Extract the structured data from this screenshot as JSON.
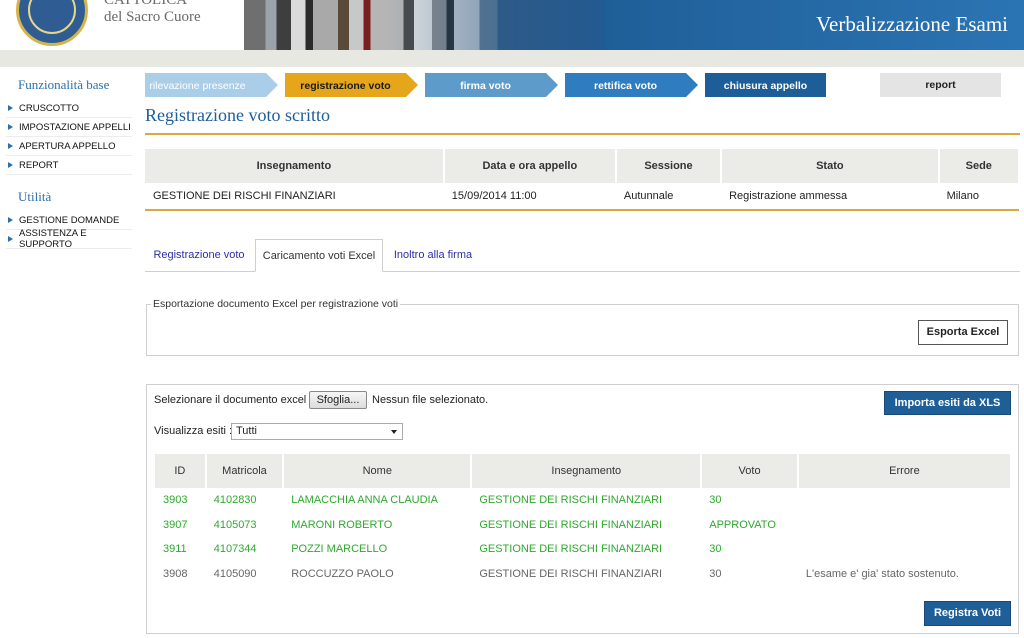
{
  "header": {
    "university_line1": "CATTOLICA",
    "university_line2": "del Sacro Cuore",
    "app_title": "Verbalizzazione Esami"
  },
  "sidebar": {
    "section1_title": "Funzionalità base",
    "section1_items": [
      "CRUSCOTTO",
      "IMPOSTAZIONE APPELLI",
      "APERTURA APPELLO",
      "REPORT"
    ],
    "section2_title": "Utilità",
    "section2_items": [
      "GESTIONE DOMANDE",
      "ASSISTENZA E SUPPORTO"
    ]
  },
  "steps": [
    {
      "label": "rilevazione presenze",
      "state": "done"
    },
    {
      "label": "registrazione voto",
      "state": "current"
    },
    {
      "label": "firma voto",
      "state": "todo"
    },
    {
      "label": "rettifica voto",
      "state": "todo"
    },
    {
      "label": "chiusura appello",
      "state": "todo-dark"
    }
  ],
  "report_label": "report",
  "page_title": "Registrazione voto scritto",
  "exam_table": {
    "headers": [
      "Insegnamento",
      "Data e ora appello",
      "Sessione",
      "Stato",
      "Sede"
    ],
    "row": [
      "GESTIONE DEI RISCHI FINANZIARI",
      "15/09/2014 11:00",
      "Autunnale",
      "Registrazione ammessa",
      "Milano"
    ]
  },
  "tabs": [
    {
      "label": "Registrazione voto",
      "active": false
    },
    {
      "label": "Caricamento voti Excel",
      "active": true
    },
    {
      "label": "Inoltro alla firma",
      "active": false
    }
  ],
  "export": {
    "legend": "Esportazione documento Excel per registrazione voti",
    "button": "Esporta Excel"
  },
  "import": {
    "select_doc_label": "Selezionare il documento excel :",
    "browse_button": "Sfoglia...",
    "no_file_text": "Nessun file selezionato.",
    "import_button": "Importa esiti da XLS",
    "filter_label": "Visualizza esiti :",
    "filter_value": "Tutti",
    "register_button": "Registra Voti"
  },
  "results": {
    "headers": [
      "ID",
      "Matricola",
      "Nome",
      "Insegnamento",
      "Voto",
      "Errore"
    ],
    "rows": [
      {
        "id": "3903",
        "matricola": "4102830",
        "nome": "LAMACCHIA ANNA CLAUDIA",
        "insegnamento": "GESTIONE DEI RISCHI FINANZIARI",
        "voto": "30",
        "errore": "",
        "status": "ok"
      },
      {
        "id": "3907",
        "matricola": "4105073",
        "nome": "MARONI ROBERTO",
        "insegnamento": "GESTIONE DEI RISCHI FINANZIARI",
        "voto": "APPROVATO",
        "errore": "",
        "status": "ok"
      },
      {
        "id": "3911",
        "matricola": "4107344",
        "nome": "POZZI MARCELLO",
        "insegnamento": "GESTIONE DEI RISCHI FINANZIARI",
        "voto": "30",
        "errore": "",
        "status": "ok"
      },
      {
        "id": "3908",
        "matricola": "4105090",
        "nome": "ROCCUZZO PAOLO",
        "insegnamento": "GESTIONE DEI RISCHI FINANZIARI",
        "voto": "30",
        "errore": "L'esame e' gia' stato sostenuto.",
        "status": "err"
      }
    ]
  },
  "colors": {
    "brand_blue": "#1f5f98",
    "accent_gold": "#d9a840",
    "step_done": "#aacde8",
    "step_current": "#e5a61c",
    "step_todo": "#5d9bcb",
    "step_todo_mid": "#2f7cbf",
    "step_todo_dark": "#1d5e98",
    "ok_green": "#2ea82e"
  }
}
